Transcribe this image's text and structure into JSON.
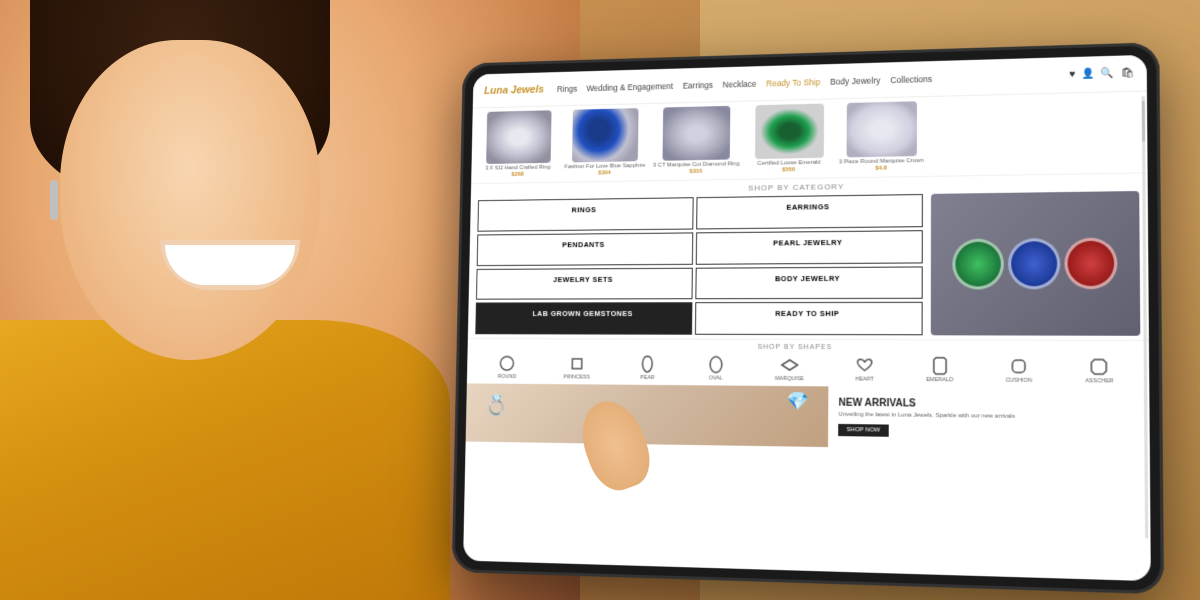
{
  "background": {
    "color_left": "#c8a060",
    "color_right": "#b89050"
  },
  "tablet": {
    "website": {
      "logo": "Luna Jewels",
      "nav": {
        "items": [
          {
            "label": "Rings",
            "active": false
          },
          {
            "label": "Wedding & Engagement",
            "active": false
          },
          {
            "label": "Earrings",
            "active": false
          },
          {
            "label": "Necklace",
            "active": false
          },
          {
            "label": "Ready To Ship",
            "active": true
          },
          {
            "label": "Body Jewelry",
            "active": false
          },
          {
            "label": "Collections",
            "active": false
          }
        ]
      },
      "icons": [
        "♥",
        "👤",
        "🔍",
        "🛍"
      ],
      "products": [
        {
          "name": "3 F SI2 Hand Crafted Ring",
          "price": "$268"
        },
        {
          "name": "Fashion For Love Blue Sapphire",
          "price": "$304"
        },
        {
          "name": "3 CT Marquise Cut Diamond Ring",
          "price": "$310"
        },
        {
          "name": "Certified Loose Emerald",
          "price": "$550"
        },
        {
          "name": "3 Piece Round Marquise Crown",
          "price": "$4.8"
        }
      ],
      "shop_by_category": {
        "label": "SHOP BY CATEGORY",
        "items": [
          {
            "label": "RINGS"
          },
          {
            "label": "EARRINGS"
          },
          {
            "label": "PENDANTS"
          },
          {
            "label": "PEARL JEWELRY"
          },
          {
            "label": "JEWELRY SETS"
          },
          {
            "label": "BODY JEWELRY"
          },
          {
            "label": "LAB GROWN GEMSTONES"
          },
          {
            "label": "READY TO SHIP"
          }
        ]
      },
      "shop_by_shapes": {
        "label": "SHOP BY SHAPES",
        "items": [
          {
            "label": "ROUND"
          },
          {
            "label": "PRINCESS"
          },
          {
            "label": "PEAR"
          },
          {
            "label": "OVAL"
          },
          {
            "label": "MARQUISE"
          },
          {
            "label": "HEART"
          },
          {
            "label": "EMERALD"
          },
          {
            "label": "CUSHION"
          },
          {
            "label": "ASSCHER"
          }
        ]
      },
      "new_arrivals": {
        "title": "NEW ARRIVALS",
        "subtitle": "Unveiling the latest in Luna Jewels. Sparkle with our new arrivals",
        "cta": "SHOP NOW"
      }
    }
  }
}
